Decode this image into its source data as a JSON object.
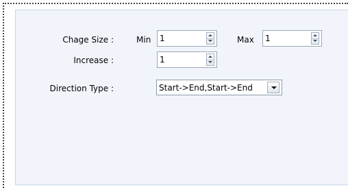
{
  "form": {
    "change_size_label": "Chage Size :",
    "min_label": "Min",
    "min_value": "1",
    "max_label": "Max",
    "max_value": "1",
    "increase_label": "Increase :",
    "increase_value": "1",
    "direction_label": "Direction Type :",
    "direction_value": "Start->End,Start->End"
  },
  "icons": {
    "spinner_up": "arrow-up-icon",
    "spinner_down": "arrow-down-icon",
    "dropdown": "chevron-down-icon"
  },
  "colors": {
    "panel_bg": "#f1f5fb",
    "panel_border": "#c8d4e4",
    "input_border": "#9aa6b6"
  }
}
